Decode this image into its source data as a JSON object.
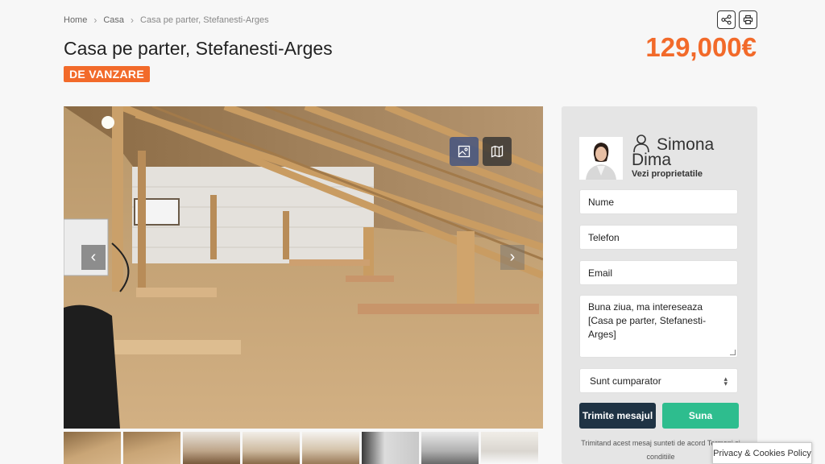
{
  "breadcrumb": {
    "home": "Home",
    "category": "Casa",
    "current": "Casa pe parter, Stefanesti-Arges"
  },
  "listing": {
    "title": "Casa pe parter, Stefanesti-Arges",
    "status": "DE VANZARE",
    "price": "129,000€"
  },
  "colors": {
    "accent": "#f26a2a",
    "dark_button": "#1f3344",
    "call_button": "#2ebd8e"
  },
  "tools": {
    "share_icon": "share-icon",
    "print_icon": "print-icon"
  },
  "gallery": {
    "image_button_icon": "image-icon",
    "map_button_icon": "map-icon",
    "prev_arrow": "‹",
    "next_arrow": "›",
    "thumbnail_count": 8
  },
  "agent": {
    "name": "Simona Dima",
    "link": "Vezi proprietatile"
  },
  "form": {
    "name_placeholder": "Nume",
    "phone_placeholder": "Telefon",
    "email_placeholder": "Email",
    "message": "Buna ziua, ma intereseaza [Casa pe parter, Stefanesti-Arges]",
    "role_selected": "Sunt cumparator",
    "send_label": "Trimite mesajul",
    "call_label": "Suna",
    "terms": "Trimitand acest mesaj sunteti de acord Termeni si conditiile"
  },
  "cookie": {
    "label": "Privacy & Cookies Policy"
  }
}
